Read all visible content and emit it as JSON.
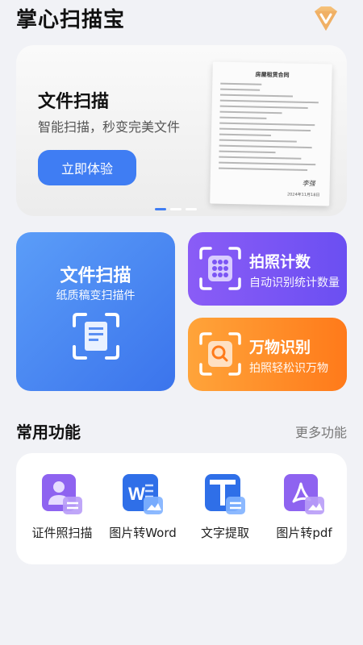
{
  "app": {
    "title": "掌心扫描宝"
  },
  "header": {
    "vip_icon": "diamond-v-icon"
  },
  "banner": {
    "title": "文件扫描",
    "subtitle": "智能扫描，秒变完美文件",
    "button_label": "立即体验",
    "document_title": "房屋租赁合同",
    "document_signature": "李强",
    "document_date": "2024年11月18日",
    "active_slide": 1,
    "slide_count": 3
  },
  "cards": {
    "document_scan": {
      "title": "文件扫描",
      "subtitle": "纸质稿变扫描件",
      "icon": "document-scan-icon"
    },
    "photo_count": {
      "title": "拍照计数",
      "subtitle": "自动识别统计数量",
      "icon": "grid-count-icon"
    },
    "object_recognition": {
      "title": "万物识别",
      "subtitle": "拍照轻松识万物",
      "icon": "magnifier-scan-icon"
    }
  },
  "common": {
    "title": "常用功能",
    "more_label": "更多功能",
    "items": [
      {
        "label": "证件照扫描",
        "icon": "id-photo-icon"
      },
      {
        "label": "图片转Word",
        "icon": "word-icon"
      },
      {
        "label": "文字提取",
        "icon": "text-extract-icon"
      },
      {
        "label": "图片转pdf",
        "icon": "pdf-icon"
      }
    ]
  },
  "colors": {
    "accent": "#3f7df3",
    "purple": "#7b55f4",
    "orange": "#ff8c22",
    "background": "#f1f2f6"
  }
}
